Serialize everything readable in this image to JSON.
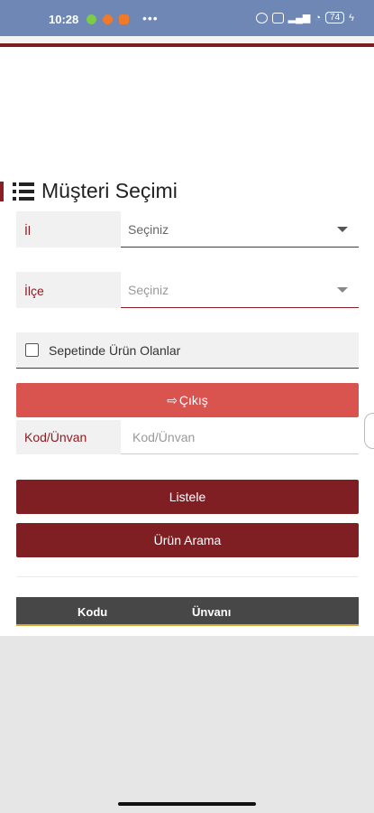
{
  "status_bar": {
    "time": "10:28",
    "battery": "74"
  },
  "page": {
    "title": "Müşteri Seçimi"
  },
  "filters": {
    "il": {
      "label": "İl",
      "value": "Seçiniz"
    },
    "ilce": {
      "label": "İlçe",
      "value": "Seçiniz"
    },
    "checkbox": {
      "label": "Sepetinde Ürün Olanlar",
      "checked": false
    }
  },
  "exit_button": {
    "label": "Çıkış"
  },
  "code_search": {
    "label": "Kod/Ünvan",
    "placeholder": "Kod/Ünvan",
    "value": ""
  },
  "buttons": {
    "list": "Listele",
    "product_search": "Ürün Arama"
  },
  "table": {
    "columns": [
      "Kodu",
      "Ünvanı"
    ]
  },
  "colors": {
    "brand": "#7f1f24",
    "exit": "#d9534f",
    "header": "#474747",
    "header_accent": "#d4a93a"
  }
}
